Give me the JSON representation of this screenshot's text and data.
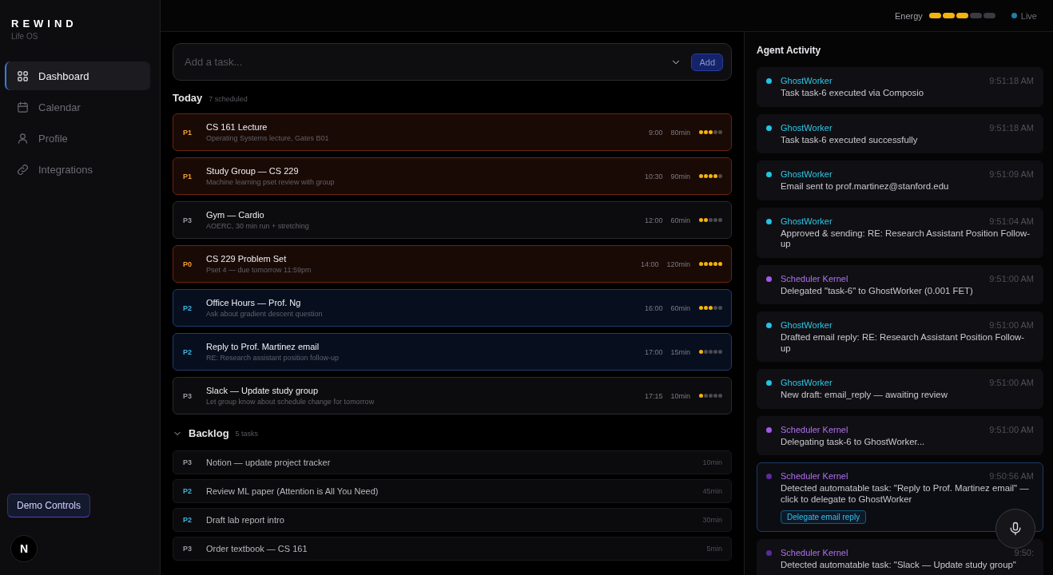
{
  "sidebar": {
    "brand": "REWIND",
    "subtitle": "Life OS",
    "items": [
      {
        "label": "Dashboard",
        "selected": true
      },
      {
        "label": "Calendar",
        "selected": false
      },
      {
        "label": "Profile",
        "selected": false
      },
      {
        "label": "Integrations",
        "selected": false
      }
    ],
    "demo_button": "Demo Controls",
    "avatar": "N"
  },
  "topbar": {
    "energy_label": "Energy",
    "energy": {
      "level": 0.6
    },
    "status": "Live"
  },
  "task_input": {
    "placeholder": "Add a task...",
    "button": "Add"
  },
  "today": {
    "title": "Today",
    "count": "7 scheduled",
    "tasks": [
      {
        "priority": "P1",
        "kind": "urgent",
        "title": "CS 161 Lecture",
        "note": "Operating Systems lecture, Gates B01",
        "time": "9:00",
        "duration": "80min",
        "stars": 3
      },
      {
        "priority": "P1",
        "kind": "urgent",
        "title": "Study Group — CS 229",
        "note": "Machine learning pset review with group",
        "time": "10:30",
        "duration": "90min",
        "stars": 4
      },
      {
        "priority": "P3",
        "kind": "plain",
        "title": "Gym — Cardio",
        "note": "AOERC, 30 min run + stretching",
        "time": "12:00",
        "duration": "60min",
        "stars": 2
      },
      {
        "priority": "P0",
        "kind": "urgent",
        "title": "CS 229 Problem Set",
        "note": "Pset 4 — due tomorrow 11:59pm",
        "time": "14:00",
        "duration": "120min",
        "stars": 5
      },
      {
        "priority": "P2",
        "kind": "focus",
        "title": "Office Hours — Prof. Ng",
        "note": "Ask about gradient descent question",
        "time": "16:00",
        "duration": "60min",
        "stars": 3
      },
      {
        "priority": "P2",
        "kind": "focus",
        "title": "Reply to Prof. Martinez email",
        "note": "RE: Research assistant position follow-up",
        "time": "17:00",
        "duration": "15min",
        "stars": 1
      },
      {
        "priority": "P3",
        "kind": "plain",
        "title": "Slack — Update study group",
        "note": "Let group know about schedule change for tomorrow",
        "time": "17:15",
        "duration": "10min",
        "stars": 1
      }
    ]
  },
  "backlog": {
    "title": "Backlog",
    "count": "5 tasks",
    "expanded": true,
    "tasks": [
      {
        "priority": "P3",
        "kind": "plain",
        "title": "Notion — update project tracker",
        "duration": "10min"
      },
      {
        "priority": "P2",
        "kind": "focus",
        "title": "Review ML paper (Attention is All You Need)",
        "duration": "45min"
      },
      {
        "priority": "P2",
        "kind": "focus",
        "title": "Draft lab report intro",
        "duration": "30min"
      },
      {
        "priority": "P3",
        "kind": "plain",
        "title": "Order textbook — CS 161",
        "duration": "5min"
      }
    ]
  },
  "activity": {
    "title": "Agent Activity",
    "items": [
      {
        "agent": "GhostWorker",
        "color": "#22c3e6",
        "time": "9:51:18 AM",
        "message": "Task task-6 executed via Composio",
        "highlighted": false
      },
      {
        "agent": "GhostWorker",
        "color": "#22c3e6",
        "time": "9:51:18 AM",
        "message": "Task task-6 executed successfully",
        "highlighted": false
      },
      {
        "agent": "GhostWorker",
        "color": "#22c3e6",
        "time": "9:51:09 AM",
        "message": "Email sent to prof.martinez@stanford.edu",
        "highlighted": false
      },
      {
        "agent": "GhostWorker",
        "color": "#22c3e6",
        "time": "9:51:04 AM",
        "message": "Approved & sending: RE: Research Assistant Position Follow-up",
        "highlighted": false
      },
      {
        "agent": "Scheduler Kernel",
        "color": "#a25ae8",
        "time": "9:51:00 AM",
        "message": "Delegated \"task-6\" to GhostWorker (0.001 FET)",
        "highlighted": false
      },
      {
        "agent": "GhostWorker",
        "color": "#22c3e6",
        "time": "9:51:00 AM",
        "message": "Drafted email reply: RE: Research Assistant Position Follow-up",
        "highlighted": false
      },
      {
        "agent": "GhostWorker",
        "color": "#22c3e6",
        "time": "9:51:00 AM",
        "message": "New draft: email_reply — awaiting review",
        "highlighted": false
      },
      {
        "agent": "Scheduler Kernel",
        "color": "#a25ae8",
        "time": "9:51:00 AM",
        "message": "Delegating task-6 to GhostWorker...",
        "highlighted": false
      },
      {
        "agent": "Scheduler Kernel",
        "color": "#5d2a9e",
        "time": "9:50:56 AM",
        "message": "Detected automatable task: \"Reply to Prof. Martinez email\" — click to delegate to GhostWorker",
        "action": "Delegate email reply",
        "highlighted": true
      },
      {
        "agent": "Scheduler Kernel",
        "color": "#5d2a9e",
        "time": "9:50:",
        "message": "Detected automatable task: \"Slack — Update study group\"",
        "highlighted": false
      }
    ]
  }
}
